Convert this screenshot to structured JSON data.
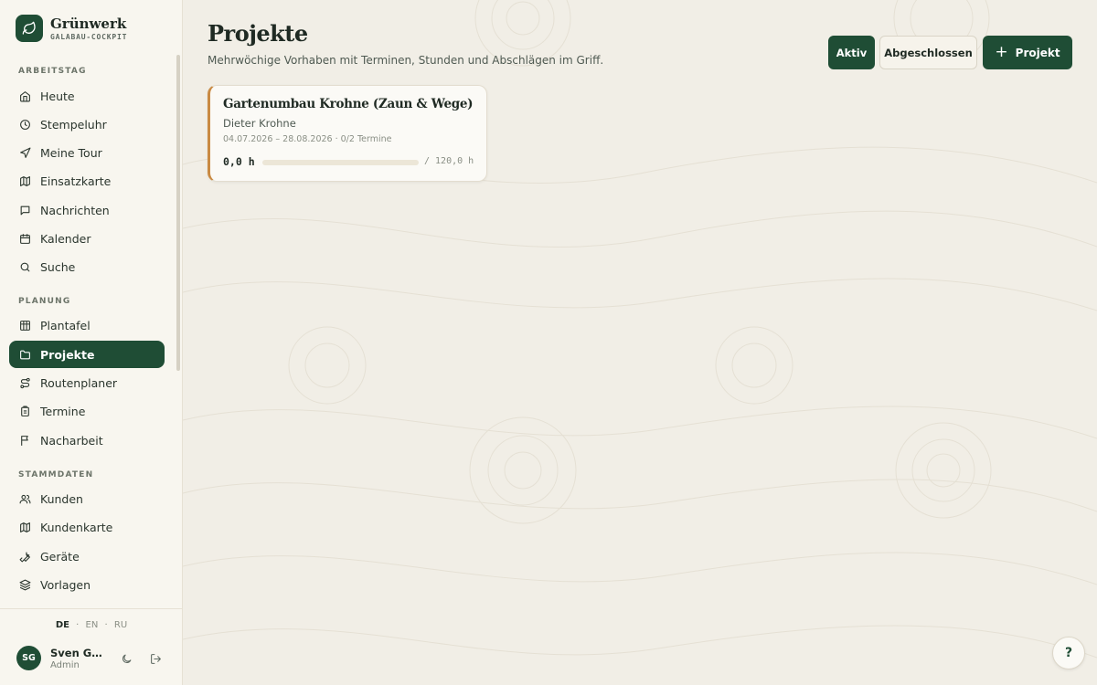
{
  "brand": {
    "name": "Grünwerk",
    "subtitle": "GALABAU-COCKPIT"
  },
  "sidebar": {
    "sections": [
      {
        "label": "ARBEITSTAG"
      },
      {
        "label": "PLANUNG"
      },
      {
        "label": "STAMMDATEN"
      }
    ],
    "items": [
      {
        "label": "Heute",
        "icon": "home-icon"
      },
      {
        "label": "Stempeluhr",
        "icon": "clock-icon"
      },
      {
        "label": "Meine Tour",
        "icon": "navigation-icon"
      },
      {
        "label": "Einsatzkarte",
        "icon": "map-icon"
      },
      {
        "label": "Nachrichten",
        "icon": "message-icon"
      },
      {
        "label": "Kalender",
        "icon": "calendar-icon"
      },
      {
        "label": "Suche",
        "icon": "search-icon"
      },
      {
        "label": "Plantafel",
        "icon": "table-icon"
      },
      {
        "label": "Projekte",
        "icon": "folder-icon",
        "active": true
      },
      {
        "label": "Routenplaner",
        "icon": "route-icon"
      },
      {
        "label": "Termine",
        "icon": "clipboard-icon"
      },
      {
        "label": "Nacharbeit",
        "icon": "flag-icon"
      },
      {
        "label": "Kunden",
        "icon": "users-icon"
      },
      {
        "label": "Kundenkarte",
        "icon": "map-icon"
      },
      {
        "label": "Geräte",
        "icon": "wrench-icon"
      },
      {
        "label": "Vorlagen",
        "icon": "layers-icon"
      }
    ],
    "languages": [
      "DE",
      "EN",
      "RU"
    ],
    "current_language": "DE",
    "user": {
      "initials": "SG",
      "name": "Sven Ga...",
      "role": "Admin"
    }
  },
  "main": {
    "title": "Projekte",
    "subtitle": "Mehrwöchige Vorhaben mit Terminen, Stunden und Abschlägen im Griff.",
    "filters": {
      "active_label": "Aktiv",
      "done_label": "Abgeschlossen"
    },
    "new_button_label": "Projekt",
    "projects": [
      {
        "title": "Gartenumbau Krohne (Zaun & Wege)",
        "client": "Dieter Krohne",
        "meta": "04.07.2026 – 28.08.2026 · 0/2 Termine",
        "hours": "0,0 h",
        "budget": "/ 120,0 h",
        "progress": 0
      }
    ],
    "help_label": "?"
  },
  "colors": {
    "primary": "#1f4d35",
    "accent": "#c98a43",
    "background": "#f1eee6"
  }
}
